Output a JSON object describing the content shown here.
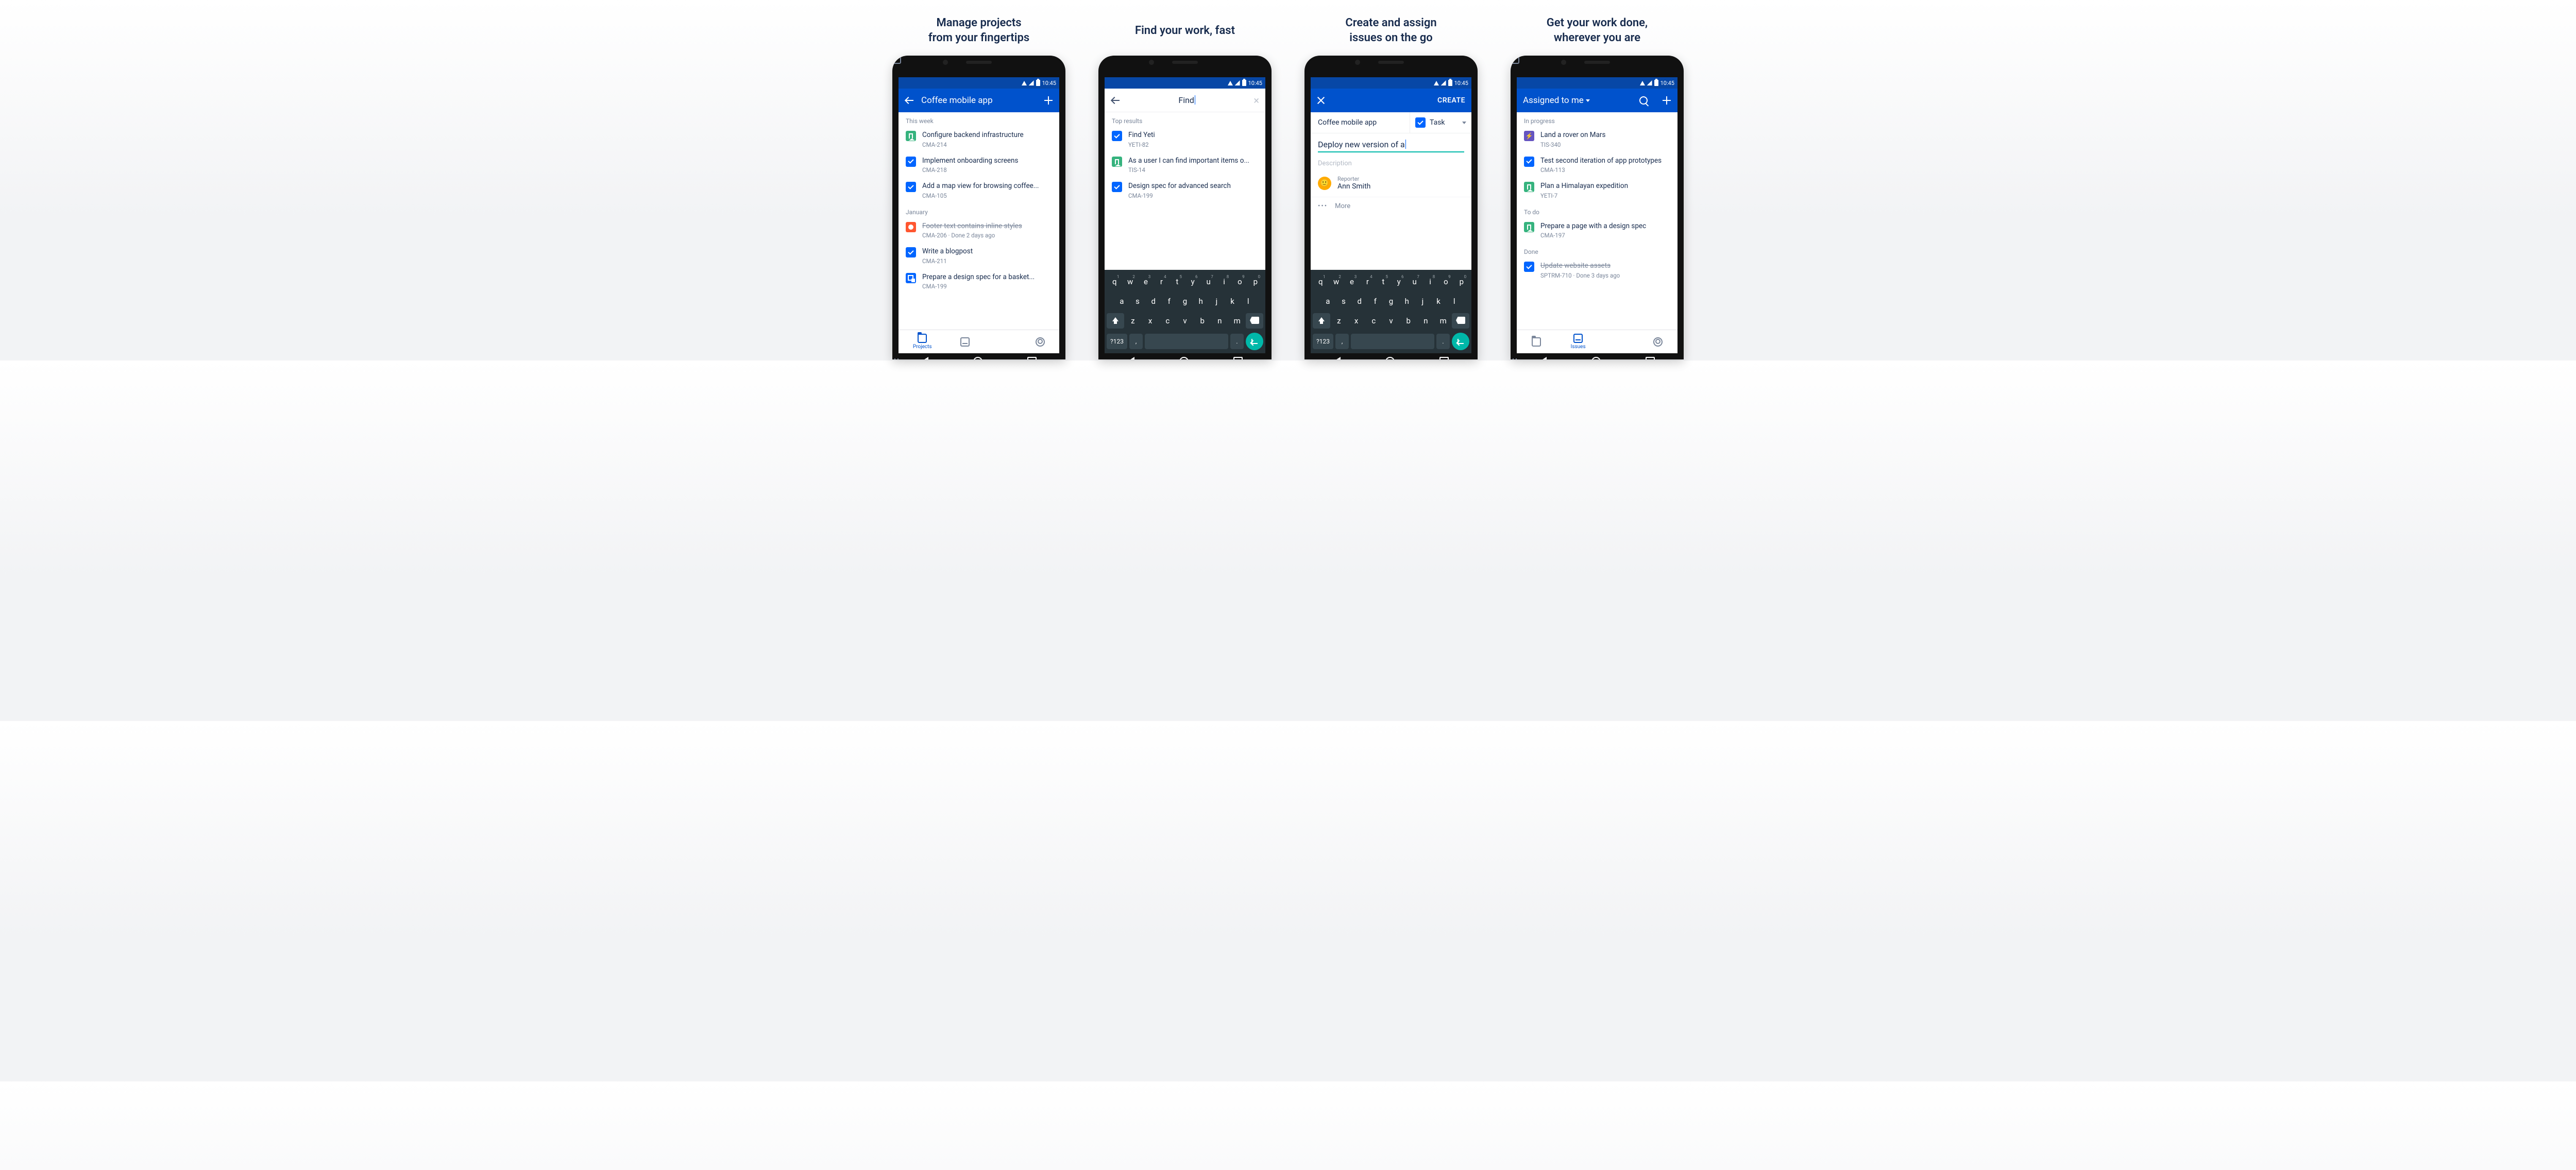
{
  "status_time": "10:45",
  "captions": [
    "Manage projects\nfrom your fingertips",
    "Find your work, fast",
    "Create and assign\nissues on the go",
    "Get your work done,\nwherever you are"
  ],
  "nav_labels": {
    "projects": "Projects",
    "issues": "Issues"
  },
  "keyboard": {
    "row1": [
      "q",
      "w",
      "e",
      "r",
      "t",
      "y",
      "u",
      "i",
      "o",
      "p"
    ],
    "row1_super": [
      "1",
      "2",
      "3",
      "4",
      "5",
      "6",
      "7",
      "8",
      "9",
      "0"
    ],
    "row2": [
      "a",
      "s",
      "d",
      "f",
      "g",
      "h",
      "j",
      "k",
      "l"
    ],
    "row3": [
      "z",
      "x",
      "c",
      "v",
      "b",
      "n",
      "m"
    ],
    "sym": "?123",
    "comma": ",",
    "period": "."
  },
  "s1": {
    "title": "Coffee mobile app",
    "g1": "This week",
    "g2": "January",
    "items1": [
      {
        "title": "Configure backend infrastructure",
        "key": "CMA-214",
        "type": "story"
      },
      {
        "title": "Implement onboarding screens",
        "key": "CMA-218",
        "type": "task"
      },
      {
        "title": "Add a map view for browsing coffee...",
        "key": "CMA-105",
        "type": "task"
      }
    ],
    "items2": [
      {
        "title": "Footer text contains inline styles",
        "key": "CMA-206 · Done 2 days ago",
        "type": "bug",
        "done": true
      },
      {
        "title": "Write a blogpost",
        "key": "CMA-211",
        "type": "task"
      },
      {
        "title": "Prepare a design spec for a basket...",
        "key": "CMA-199",
        "type": "sub"
      }
    ]
  },
  "s2": {
    "query": "Find",
    "header": "Top results",
    "items": [
      {
        "title": "Find Yeti",
        "key": "YETI-82",
        "type": "task"
      },
      {
        "title": "As a user I can find important items o...",
        "key": "TIS-14",
        "type": "story"
      },
      {
        "title": "Design spec for advanced search",
        "key": "CMA-199",
        "type": "task"
      }
    ]
  },
  "s3": {
    "create": "CREATE",
    "project": "Coffee mobile app",
    "type": "Task",
    "summary": "Deploy new version of a",
    "desc_ph": "Description",
    "reporter_lbl": "Reporter",
    "reporter": "Ann Smith",
    "more": "More"
  },
  "s4": {
    "title": "Assigned to me",
    "g1": "In progress",
    "g2": "To do",
    "g3": "Done",
    "items1": [
      {
        "title": "Land a rover on Mars",
        "key": "TIS-340",
        "type": "epic"
      },
      {
        "title": "Test second iteration of app prototypes",
        "key": "CMA-113",
        "type": "task"
      },
      {
        "title": "Plan a Himalayan expedition",
        "key": "YETI-7",
        "type": "story"
      }
    ],
    "items2": [
      {
        "title": "Prepare a page with a design spec",
        "key": "CMA-197",
        "type": "story"
      }
    ],
    "items3": [
      {
        "title": "Update website assets",
        "key": "SPTRM-710 · Done 3 days ago",
        "type": "task",
        "done": true
      }
    ]
  }
}
